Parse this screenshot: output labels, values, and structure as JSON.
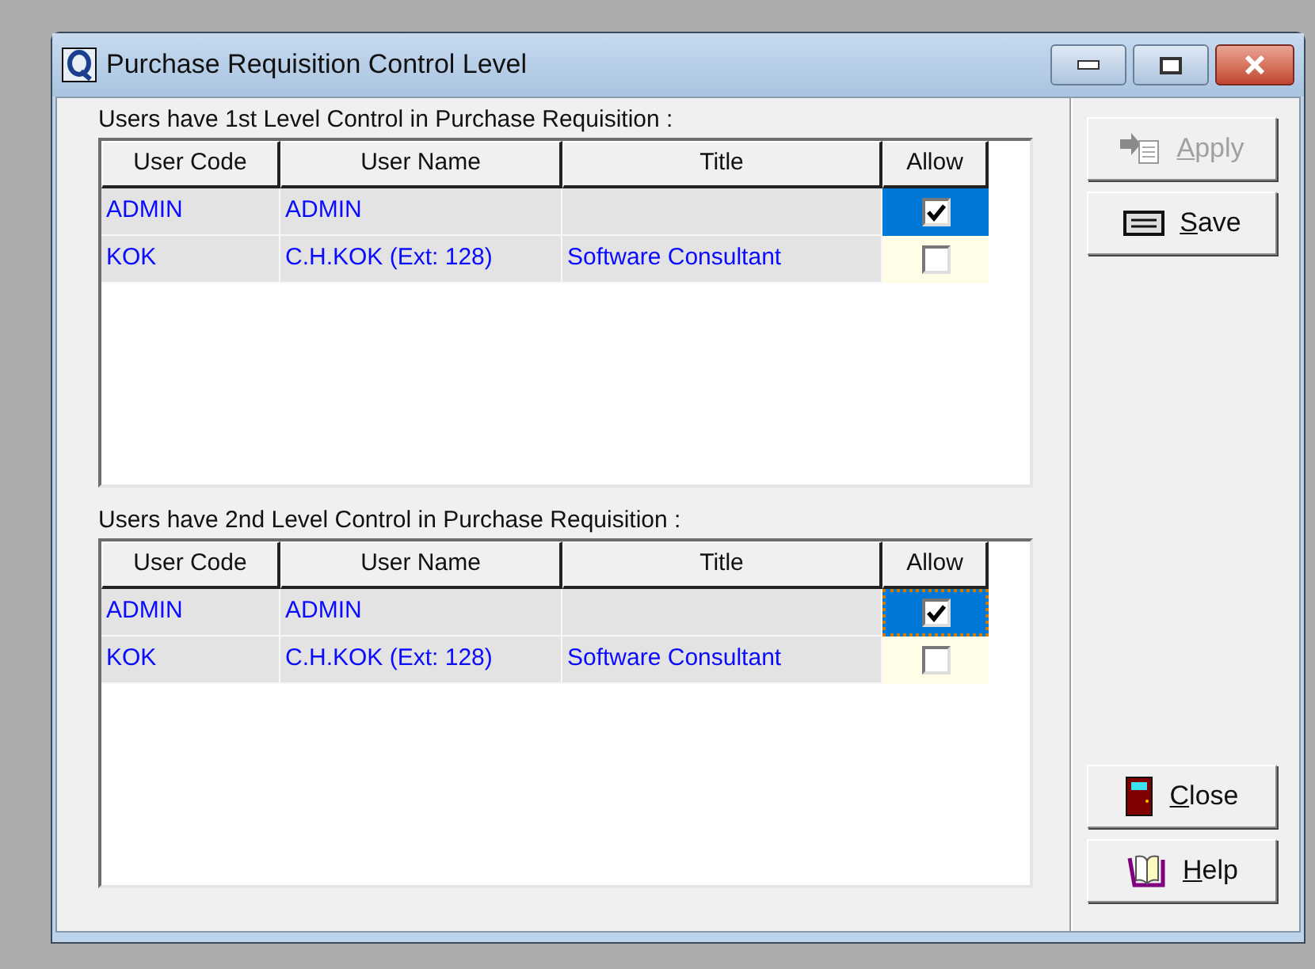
{
  "window": {
    "title": "Purchase Requisition Control Level"
  },
  "tables": [
    {
      "label": "Users have 1st Level Control in Purchase Requisition :",
      "focused": false,
      "columns": [
        "User Code",
        "User Name",
        "Title",
        "Allow"
      ],
      "rows": [
        {
          "user_code": "ADMIN",
          "user_name": "ADMIN",
          "title": "",
          "allow": true,
          "selected": true
        },
        {
          "user_code": "KOK",
          "user_name": "C.H.KOK (Ext: 128)",
          "title": "Software Consultant",
          "allow": false,
          "selected": false
        }
      ]
    },
    {
      "label": "Users have 2nd Level Control in Purchase Requisition :",
      "focused": true,
      "columns": [
        "User Code",
        "User Name",
        "Title",
        "Allow"
      ],
      "rows": [
        {
          "user_code": "ADMIN",
          "user_name": "ADMIN",
          "title": "",
          "allow": true,
          "selected": true
        },
        {
          "user_code": "KOK",
          "user_name": "C.H.KOK (Ext: 128)",
          "title": "Software Consultant",
          "allow": false,
          "selected": false
        }
      ]
    }
  ],
  "buttons": [
    {
      "label": "Apply",
      "kind": "apply",
      "disabled": true
    },
    {
      "label": "Save",
      "kind": "save",
      "disabled": false
    },
    {
      "label": "Close",
      "kind": "close",
      "disabled": false
    },
    {
      "label": "Help",
      "kind": "help",
      "disabled": false
    }
  ]
}
